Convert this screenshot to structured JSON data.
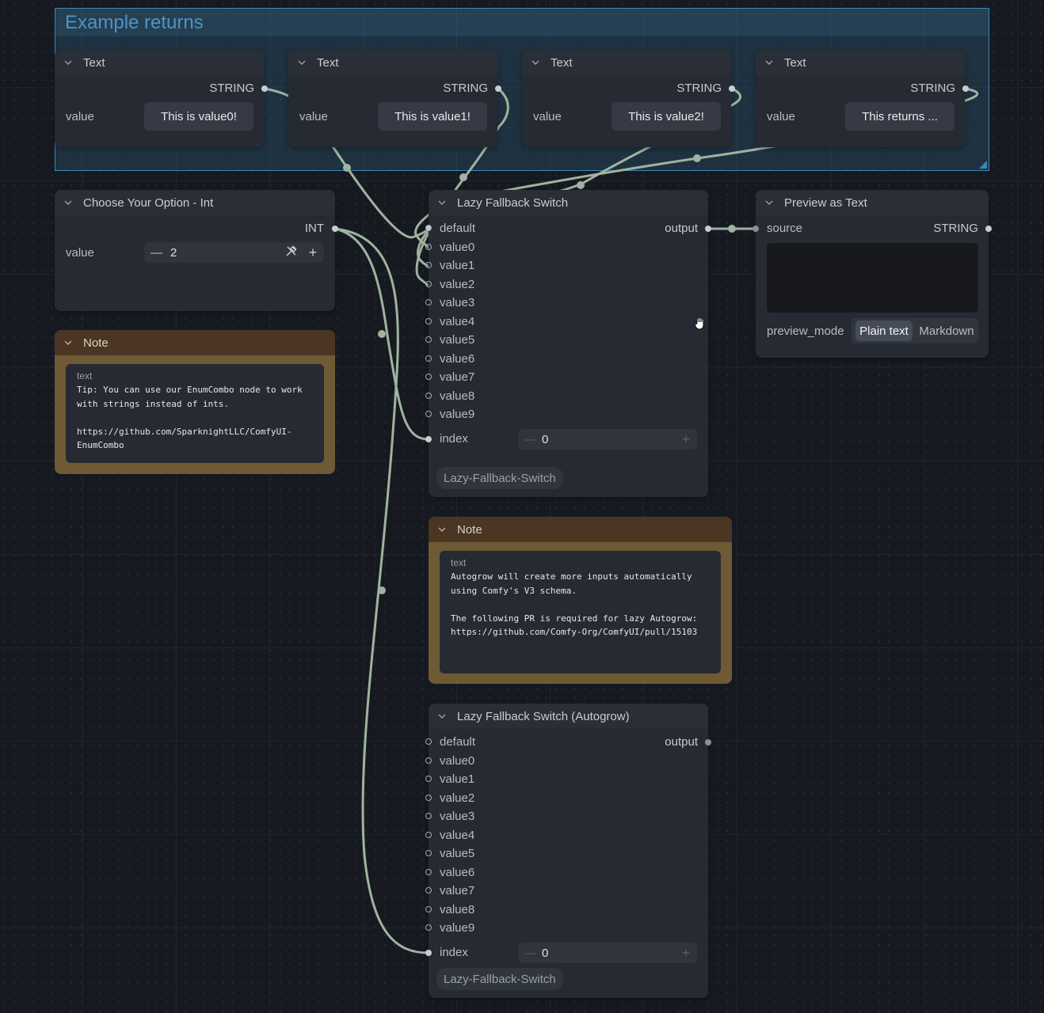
{
  "group": {
    "title": "Example returns"
  },
  "text_nodes": [
    {
      "title": "Text",
      "output": "STRING",
      "label": "value",
      "value": "This is value0!"
    },
    {
      "title": "Text",
      "output": "STRING",
      "label": "value",
      "value": "This is value1!"
    },
    {
      "title": "Text",
      "output": "STRING",
      "label": "value",
      "value": "This is value2!"
    },
    {
      "title": "Text",
      "output": "STRING",
      "label": "value",
      "value": "This returns ..."
    }
  ],
  "choose_node": {
    "title": "Choose Your Option - Int",
    "output": "INT",
    "label": "value",
    "value": "2",
    "minus": "—",
    "plus": "+"
  },
  "note1": {
    "title": "Note",
    "label": "text",
    "lines": [
      "Tip: You can use our EnumCombo node to work",
      "with strings instead of ints.",
      "",
      "https://github.com/SparknightLLC/ComfyUI-",
      "EnumCombo"
    ]
  },
  "lazy_node": {
    "title": "Lazy Fallback Switch",
    "output": "output",
    "inputs": [
      "default",
      "value0",
      "value1",
      "value2",
      "value3",
      "value4",
      "value5",
      "value6",
      "value7",
      "value8",
      "value9"
    ],
    "index_label": "index",
    "index_value": "0",
    "minus": "—",
    "plus": "+",
    "badge": "Lazy-Fallback-Switch"
  },
  "preview_node": {
    "title": "Preview as Text",
    "input": "source",
    "output": "STRING",
    "mode_label": "preview_mode",
    "mode_options": [
      "Plain text",
      "Markdown"
    ],
    "mode_selected": "Plain text"
  },
  "note2": {
    "title": "Note",
    "label": "text",
    "lines": [
      "Autogrow will create more inputs automatically",
      "using Comfy's V3 schema.",
      "",
      "The following PR is required for lazy Autogrow:",
      "https://github.com/Comfy-Org/ComfyUI/pull/15103"
    ]
  },
  "auto_node": {
    "title": "Lazy Fallback Switch (Autogrow)",
    "output": "output",
    "inputs": [
      "default",
      "value0",
      "value1",
      "value2",
      "value3",
      "value4",
      "value5",
      "value6",
      "value7",
      "value8",
      "value9"
    ],
    "index_label": "index",
    "index_value": "0",
    "minus": "—",
    "plus": "+",
    "badge": "Lazy-Fallback-Switch"
  },
  "colors": {
    "link": "#9fb3a0",
    "group": "#3d85b3",
    "note": "#6e5a34"
  }
}
